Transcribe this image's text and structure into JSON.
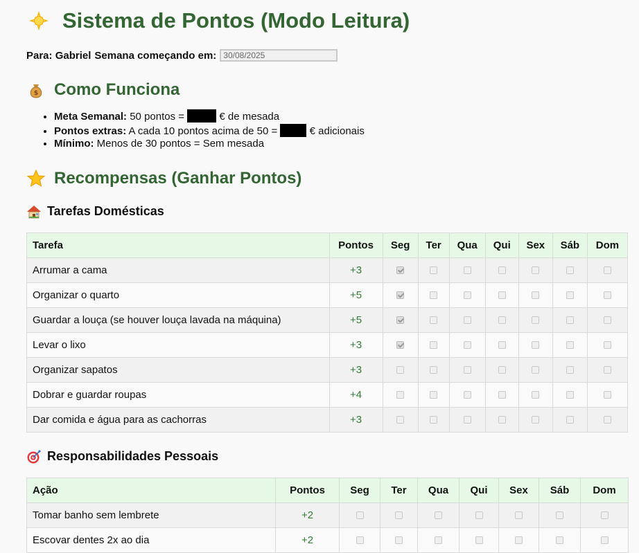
{
  "header": {
    "title": "Sistema de Pontos (Modo Leitura)",
    "icon": "sun-icon"
  },
  "week": {
    "for_label": "Para: Gabriel",
    "start_label": "Semana começando em:",
    "start_date": "30/08/2025"
  },
  "how": {
    "title": "Como Funciona",
    "icon": "money-bag-icon",
    "rules": [
      {
        "bold": "Meta Semanal:",
        "before": "50 pontos =",
        "after": "€ de mesada"
      },
      {
        "bold": "Pontos extras:",
        "before": "A cada 10 pontos acima de 50 =",
        "after": "€ adicionais"
      },
      {
        "bold": "Mínimo:",
        "before": "Menos de 30 pontos = Sem mesada",
        "after": ""
      }
    ]
  },
  "rewards": {
    "title": "Recompensas (Ganhar Pontos)",
    "icon": "star-icon"
  },
  "days": [
    "Seg",
    "Ter",
    "Qua",
    "Qui",
    "Sex",
    "Sáb",
    "Dom"
  ],
  "chores": {
    "title": "Tarefas Domésticas",
    "icon": "house-icon",
    "col_task": "Tarefa",
    "col_points": "Pontos",
    "rows": [
      {
        "task": "Arrumar a cama",
        "points": "+3",
        "checked": [
          true,
          false,
          false,
          false,
          false,
          false,
          false
        ]
      },
      {
        "task": "Organizar o quarto",
        "points": "+5",
        "checked": [
          true,
          false,
          false,
          false,
          false,
          false,
          false
        ]
      },
      {
        "task": "Guardar a louça (se houver louça lavada na máquina)",
        "points": "+5",
        "checked": [
          true,
          false,
          false,
          false,
          false,
          false,
          false
        ]
      },
      {
        "task": "Levar o lixo",
        "points": "+3",
        "checked": [
          true,
          false,
          false,
          false,
          false,
          false,
          false
        ]
      },
      {
        "task": "Organizar sapatos",
        "points": "+3",
        "checked": [
          false,
          false,
          false,
          false,
          false,
          false,
          false
        ]
      },
      {
        "task": "Dobrar e guardar roupas",
        "points": "+4",
        "checked": [
          false,
          false,
          false,
          false,
          false,
          false,
          false
        ]
      },
      {
        "task": "Dar comida e água para as cachorras",
        "points": "+3",
        "checked": [
          false,
          false,
          false,
          false,
          false,
          false,
          false
        ]
      }
    ]
  },
  "personal": {
    "title": "Responsabilidades Pessoais",
    "icon": "target-icon",
    "col_task": "Ação",
    "col_points": "Pontos",
    "rows": [
      {
        "task": "Tomar banho sem lembrete",
        "points": "+2",
        "checked": [
          false,
          false,
          false,
          false,
          false,
          false,
          false
        ]
      },
      {
        "task": "Escovar dentes 2x ao dia",
        "points": "+2",
        "checked": [
          false,
          false,
          false,
          false,
          false,
          false,
          false
        ]
      }
    ]
  }
}
